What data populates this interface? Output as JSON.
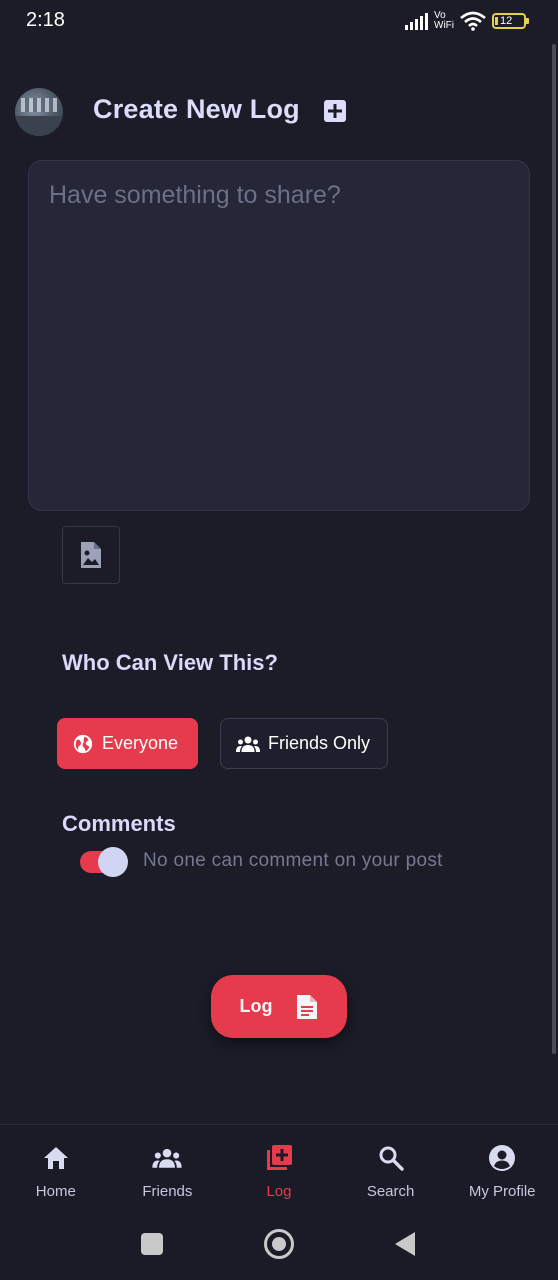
{
  "status_bar": {
    "time": "2:18",
    "network_label_top": "Vo",
    "network_label_bottom": "WiFi",
    "battery": "12"
  },
  "header": {
    "title": "Create New Log",
    "title_icon": "add-box-icon"
  },
  "post": {
    "placeholder": "Have something to share?",
    "value": ""
  },
  "attach": {
    "icon": "image-file-icon"
  },
  "visibility": {
    "heading": "Who Can View This?",
    "options": [
      {
        "label": "Everyone",
        "icon": "globe-icon",
        "selected": true
      },
      {
        "label": "Friends Only",
        "icon": "group-icon",
        "selected": false
      }
    ]
  },
  "comments": {
    "heading": "Comments",
    "toggle_on": true,
    "toggle_label": "No one can comment on your post"
  },
  "submit": {
    "label": "Log",
    "icon": "document-icon"
  },
  "bottom_nav": {
    "items": [
      {
        "label": "Home",
        "icon": "home-icon",
        "active": false
      },
      {
        "label": "Friends",
        "icon": "group-icon",
        "active": false
      },
      {
        "label": "Log",
        "icon": "add-library-icon",
        "active": true
      },
      {
        "label": "Search",
        "icon": "search-icon",
        "active": false
      },
      {
        "label": "My Profile",
        "icon": "account-circle-icon",
        "active": false
      }
    ]
  },
  "colors": {
    "background": "#1b1c28",
    "accent": "#e63b4c",
    "heading": "#dcdcfb",
    "muted": "#767a90"
  }
}
